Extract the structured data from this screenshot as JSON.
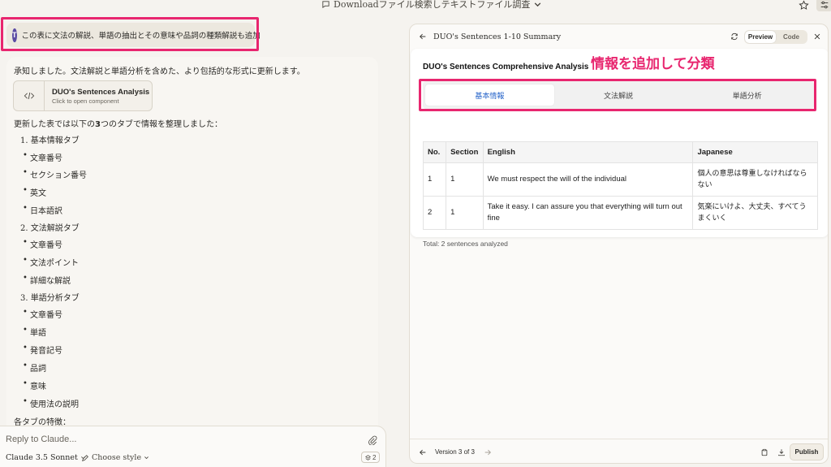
{
  "topbar": {
    "conversation_title": "Downloadファイル検索しテキストファイル調査"
  },
  "user_message": {
    "avatar_initial": "T",
    "text": "この表に文法の解説、単語の抽出とその意味や品詞の種類解説も追加"
  },
  "assistant_message": {
    "intro": "承知しました。文法解説と単語分析を含めた、より包括的な形式に更新します。",
    "artifact": {
      "name": "DUO's Sentences Analysis",
      "subtitle": "Click to open component"
    },
    "summary_before": "更新した表では以下の",
    "summary_number": "3",
    "summary_after": "つのタブで情報を整理しました：",
    "sections": [
      {
        "label": "1. 基本情報タブ",
        "items": [
          "文章番号",
          "セクション番号",
          "英文",
          "日本語訳"
        ]
      },
      {
        "label": "2. 文法解説タブ",
        "items": [
          "文章番号",
          "文法ポイント",
          "詳細な解説"
        ]
      },
      {
        "label": "3. 単語分析タブ",
        "items": [
          "文章番号",
          "単語",
          "発音記号",
          "品詞",
          "意味",
          "使用法の説明"
        ]
      }
    ],
    "closing": "各タブの特徴："
  },
  "composer": {
    "placeholder": "Reply to Claude...",
    "model": "Claude 3.5 Sonnet",
    "style": "Choose style",
    "attachment_count": "2"
  },
  "panel": {
    "title": "DUO's Sentences 1-10 Summary",
    "view_toggle": {
      "preview": "Preview",
      "code": "Code"
    },
    "card_title": "DUO's Sentences Comprehensive Analysis",
    "annotation": "情報を追加して分類",
    "tabs": [
      {
        "label": "基本情報",
        "active": true
      },
      {
        "label": "文法解説",
        "active": false
      },
      {
        "label": "単語分析",
        "active": false
      }
    ],
    "table": {
      "headers": [
        "No.",
        "Section",
        "English",
        "Japanese"
      ],
      "rows": [
        {
          "no": "1",
          "section": "1",
          "english": "We must respect the will of the individual",
          "japanese": "個人の意思は尊重しなければならない"
        },
        {
          "no": "2",
          "section": "1",
          "english": "Take it easy. I can assure you that everything will turn out fine",
          "japanese": "気楽にいけよ、大丈夫、すべてうまくいく"
        }
      ]
    },
    "total": "Total: 2 sentences analyzed",
    "footer": {
      "version": "Version 3 of 3",
      "publish": "Publish"
    }
  },
  "colors": {
    "highlight": "#e8266f",
    "active_tab_text": "#2563c9",
    "avatar": "#5b4ca3"
  }
}
